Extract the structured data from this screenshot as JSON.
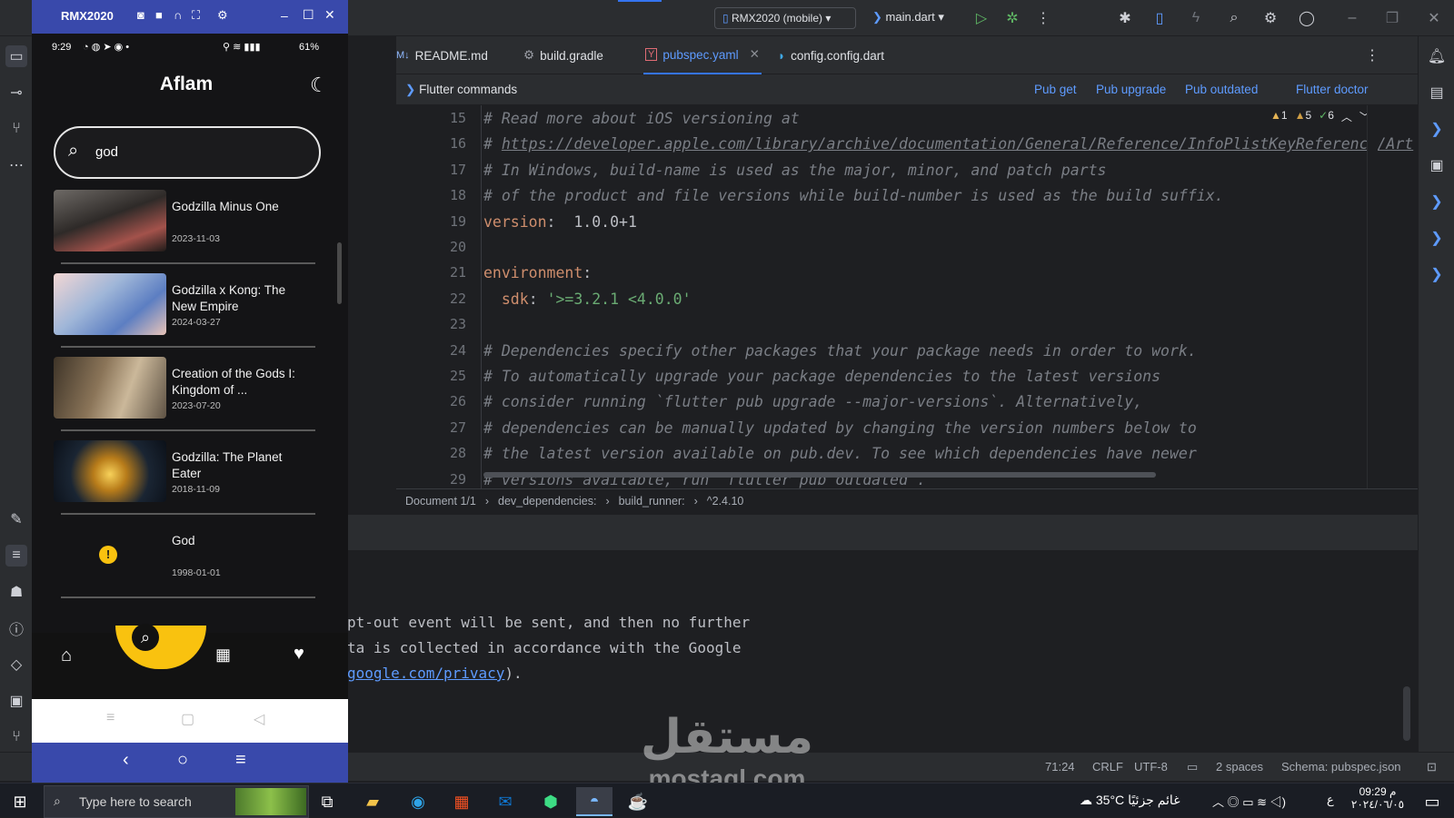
{
  "ide": {
    "device_selector": "RMX2020 (mobile)",
    "run_config": "main.dart",
    "tabs": [
      {
        "label": "README.md",
        "icon": "markdown-icon"
      },
      {
        "label": "build.gradle",
        "icon": "gradle-icon"
      },
      {
        "label": "pubspec.yaml",
        "icon": "yaml-icon"
      },
      {
        "label": "config.config.dart",
        "icon": "dart-icon"
      }
    ],
    "commands_bar": {
      "title": "Flutter commands",
      "pub_get": "Pub get",
      "pub_upgrade": "Pub upgrade",
      "pub_outdated": "Pub outdated",
      "flutter_doctor": "Flutter doctor"
    },
    "inspections": {
      "errors": "1",
      "warnings": "5",
      "ok": "6"
    },
    "code_lines": [
      {
        "n": "15",
        "text": "# Read more about iOS versioning at"
      },
      {
        "n": "16",
        "text": "https://developer.apple.com/library/archive/documentation/General/Reference/InfoPlistKeyReference/Art"
      },
      {
        "n": "17",
        "text": "# In Windows, build-name is used as the major, minor, and patch parts"
      },
      {
        "n": "18",
        "text": "# of the product and file versions while build-number is used as the build suffix."
      },
      {
        "n": "19",
        "key": "version",
        "value": " 1.0.0+1"
      },
      {
        "n": "20",
        "text": ""
      },
      {
        "n": "21",
        "key": "environment",
        "value": ""
      },
      {
        "n": "22",
        "key": "sdk",
        "value": "'>=3.2.1 <4.0.0'"
      },
      {
        "n": "23",
        "text": ""
      },
      {
        "n": "24",
        "text": "# Dependencies specify other packages that your package needs in order to work."
      },
      {
        "n": "25",
        "text": "# To automatically upgrade your package dependencies to the latest versions"
      },
      {
        "n": "26",
        "text": "# consider running `flutter pub upgrade --major-versions`. Alternatively,"
      },
      {
        "n": "27",
        "text": "# dependencies can be manually updated by changing the version numbers below to"
      },
      {
        "n": "28",
        "text": "# the latest version available on pub.dev. To see which dependencies have newer"
      },
      {
        "n": "29",
        "text": "# versions available, run `flutter pub outdated`."
      }
    ],
    "breadcrumb": [
      "Document 1/1",
      "dev_dependencies:",
      "build_runner:",
      "^2.4.10"
    ],
    "terminal": {
      "line1": "pt-out event will be sent, and then no further",
      "line2": "ta is collected in accordance with the Google",
      "link": "google.com/privacy",
      "line3_suffix": ")."
    },
    "status": {
      "position": "71:24",
      "line_sep": "CRLF",
      "encoding": "UTF-8",
      "indent": "2 spaces",
      "schema": "Schema: pubspec.json"
    }
  },
  "emulator": {
    "title": "RMX2020",
    "phone_status": {
      "time": "9:29",
      "battery": "61%"
    },
    "app": {
      "title": "Aflam",
      "search_value": "god",
      "results": [
        {
          "title": "Godzilla Minus One",
          "date": "2023-11-03"
        },
        {
          "title": "Godzilla x Kong: The New Empire",
          "date": "2024-03-27"
        },
        {
          "title": "Creation of the Gods I: Kingdom of ...",
          "date": "2023-07-20"
        },
        {
          "title": "Godzilla: The Planet Eater",
          "date": "2018-11-09"
        },
        {
          "title": "God",
          "date": "1998-01-01"
        }
      ]
    }
  },
  "taskbar": {
    "search_placeholder": "Type here to search",
    "weather_temp": "35°C",
    "weather_text": "غائم جزئيًا",
    "lang": "ع",
    "clock_time": "09:29 م",
    "clock_date": "٢٠٢٤/٠٦/٠٥"
  },
  "watermark": {
    "arabic": "مستقل",
    "latin": "mostaql.com"
  },
  "colors": {
    "accent": "#3574f0",
    "app_yellow": "#f9c20f",
    "host_nav": "#3949ab"
  }
}
